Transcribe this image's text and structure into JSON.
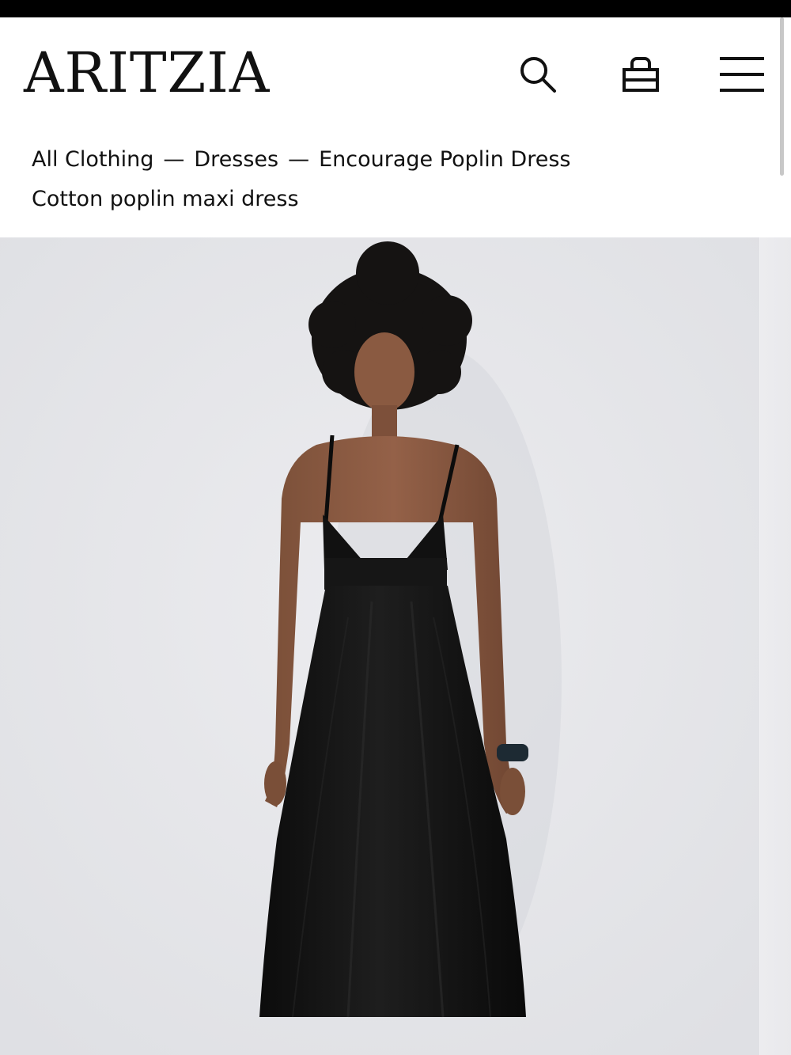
{
  "brand": {
    "logo_text": "ARITZIA"
  },
  "header": {
    "icons": [
      "search-icon",
      "bag-icon",
      "menu-icon"
    ]
  },
  "breadcrumb": {
    "items": [
      "All Clothing",
      "Dresses",
      "Encourage Poplin Dress"
    ],
    "separator": "—"
  },
  "product": {
    "subtitle": "Cotton poplin maxi dress",
    "image_description": "Model in black poplin maxi dress"
  },
  "colors": {
    "background": "#ffffff",
    "text": "#111111",
    "status_bar": "#000000",
    "image_backdrop": "#e5e5e9",
    "dress": "#111111"
  }
}
